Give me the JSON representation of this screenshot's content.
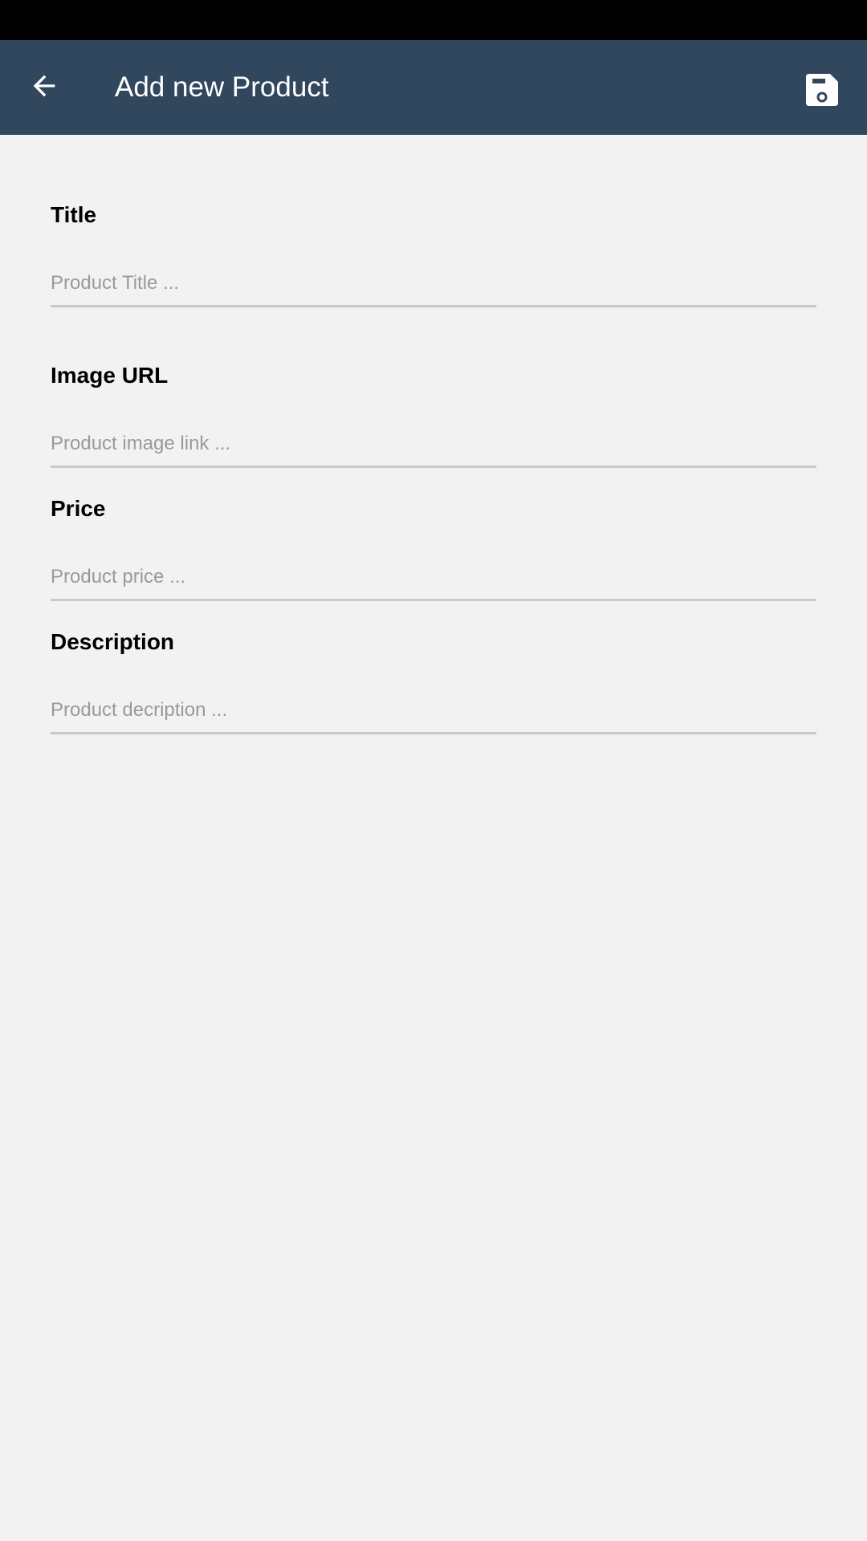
{
  "app_bar": {
    "title": "Add new Product",
    "background_color": "#31475e",
    "back_icon": "arrow-left-icon",
    "save_icon": "floppy-disk-icon"
  },
  "form": {
    "fields": [
      {
        "label": "Title",
        "placeholder": "Product Title ...",
        "value": ""
      },
      {
        "label": "Image URL",
        "placeholder": "Product image link ...",
        "value": ""
      },
      {
        "label": "Price",
        "placeholder": "Product price ...",
        "value": ""
      },
      {
        "label": "Description",
        "placeholder": "Product decription ...",
        "value": ""
      }
    ]
  }
}
